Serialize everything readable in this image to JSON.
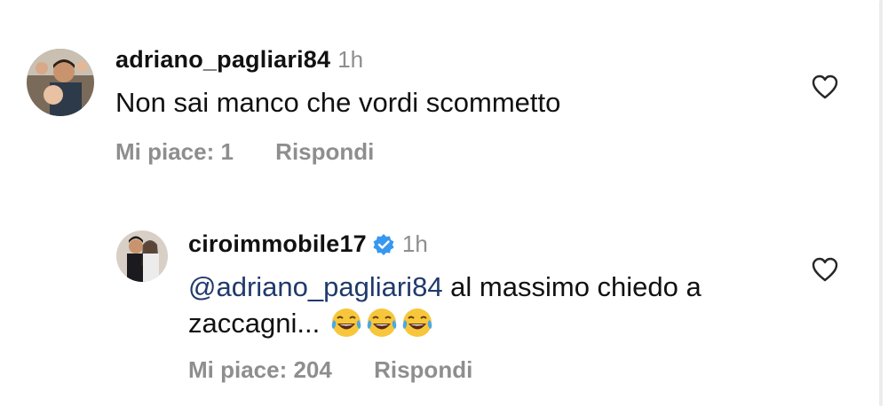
{
  "comments": [
    {
      "username": "adriano_pagliari84",
      "time": "1h",
      "text": "Non sai manco che vordi scommetto",
      "likes_label": "Mi piace: 1",
      "reply_label": "Rispondi",
      "verified": false
    },
    {
      "username": "ciroimmobile17",
      "time": "1h",
      "mention": "@adriano_pagliari84",
      "text_after_mention": " al massimo chiedo a",
      "text_line2": "zaccagni...",
      "emojis": [
        "face-with-tears-of-joy",
        "face-with-tears-of-joy",
        "face-with-tears-of-joy"
      ],
      "likes_label": "Mi piace: 204",
      "reply_label": "Rispondi",
      "verified": true
    }
  ],
  "icons": {
    "like": "heart-outline-icon",
    "verified": "verified-badge-icon"
  },
  "colors": {
    "text": "#111111",
    "secondary": "#8e8e8e",
    "mention": "#203a6b",
    "verified": "#3897f0"
  }
}
